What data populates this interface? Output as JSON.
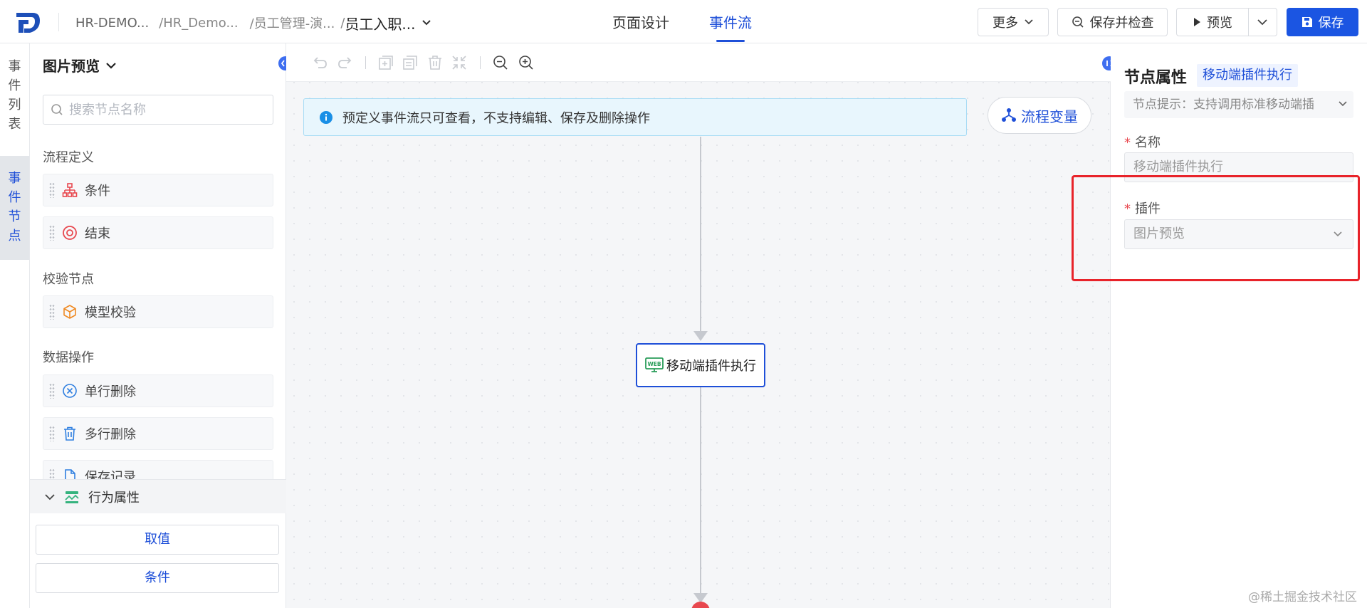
{
  "header": {
    "breadcrumbs": [
      "HR-DEMO...",
      "/HR_Demo...",
      "/员工管理-演...",
      "/"
    ],
    "current": "员工入职...",
    "tabs": [
      {
        "label": "页面设计",
        "active": false
      },
      {
        "label": "事件流",
        "active": true
      }
    ],
    "buttons": {
      "more": "更多",
      "save_check": "保存并检查",
      "preview": "预览",
      "save": "保存"
    }
  },
  "rail": {
    "items": [
      {
        "label": "事件列表",
        "chars": [
          "事",
          "件",
          "列",
          "表"
        ],
        "active": false
      },
      {
        "label": "事件节点",
        "chars": [
          "事",
          "件",
          "节",
          "点"
        ],
        "active": true
      }
    ]
  },
  "node_panel": {
    "title": "图片预览",
    "search_placeholder": "搜索节点名称",
    "sections": [
      {
        "title": "流程定义",
        "items": [
          {
            "label": "条件",
            "icon": "branch-icon"
          },
          {
            "label": "结束",
            "icon": "stop-icon"
          }
        ]
      },
      {
        "title": "校验节点",
        "items": [
          {
            "label": "模型校验",
            "icon": "cube-icon"
          }
        ]
      },
      {
        "title": "数据操作",
        "items": [
          {
            "label": "单行删除",
            "icon": "x-circle-icon"
          },
          {
            "label": "多行删除",
            "icon": "trash-icon"
          },
          {
            "label": "保存记录",
            "icon": "document-icon"
          }
        ]
      }
    ],
    "behavior_title": "行为属性",
    "behavior_buttons": [
      "取值",
      "条件"
    ]
  },
  "canvas": {
    "notice": "预定义事件流只可查看，不支持编辑、保存及删除操作",
    "variables_button": "流程变量",
    "node_label": "移动端插件执行",
    "node_icon_text": "WEB"
  },
  "properties": {
    "title": "节点属性",
    "tag": "移动端插件执行",
    "hint": "节点提示：支持调用标准移动端插",
    "name_label": "名称",
    "name_value": "移动端插件执行",
    "plugin_label": "插件",
    "plugin_value": "图片预览",
    "required_mark": "*"
  },
  "watermark": "@稀土掘金技术社区",
  "colors": {
    "accent": "#1e4fd8",
    "primary_button": "#1b55e2",
    "notice_bg": "#e8f6fd",
    "highlight": "#e8232a",
    "end_node": "#e8484f"
  }
}
